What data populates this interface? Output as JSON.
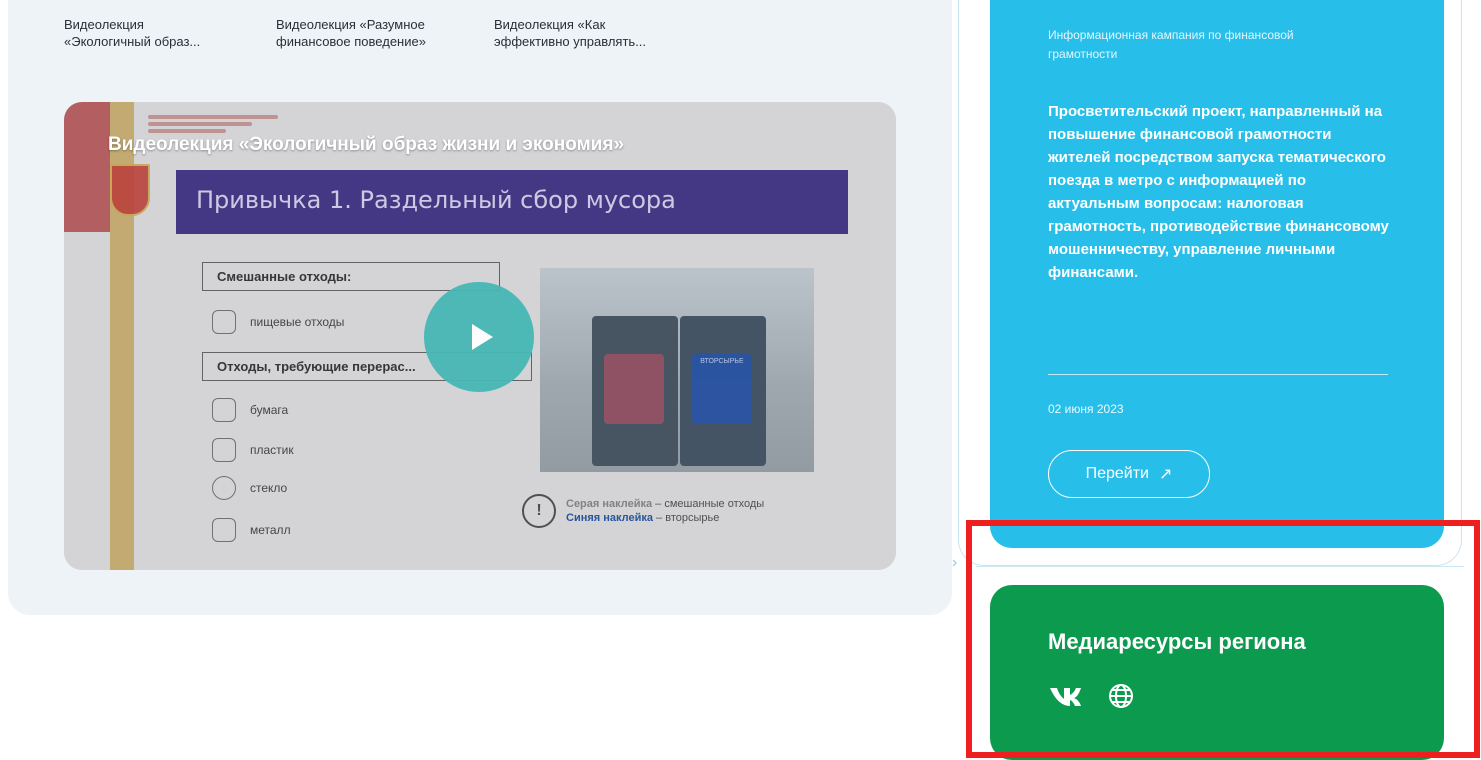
{
  "tabs": [
    {
      "line1": "Видеолекция",
      "line2": "«Экологичный образ..."
    },
    {
      "line1": "Видеолекция «Разумное",
      "line2": "финансовое поведение»"
    },
    {
      "line1": "Видеолекция «Как",
      "line2": "эффективно управлять..."
    }
  ],
  "video": {
    "title": "Видеолекция «Экологичный образ жизни и экономия»",
    "slide_heading": "Привычка 1. Раздельный сбор мусора",
    "mixed_header": "Смешанные отходы:",
    "food_waste": "пищевые отходы",
    "recycle_header": "Отходы, требующие перерас...",
    "paper": "бумага",
    "plastic": "пластик",
    "glass": "стекло",
    "metal": "металл",
    "legend_gray": "Серая наклейка",
    "legend_gray_rest": " – смешанные отходы",
    "legend_blue": "Синяя наклейка",
    "legend_blue_rest": " – вторсырье",
    "sticker_text": "ВТОРСЫРЬЕ"
  },
  "blue_card": {
    "category": "Информационная кампания по финансовой грамотности",
    "description": "Просветительский проект, направленный на повышение финансовой грамотности жителей посредством запуска тематического поезда в метро с информацией по актуальным вопросам: налоговая грамотность, противодействие финансовому мошенничеству, управление личными финансами.",
    "date": "02 июня 2023",
    "go_label": "Перейти",
    "go_arrow": "↗"
  },
  "green_card": {
    "title": "Медиаресурсы региона",
    "vk_label": "ВК"
  },
  "colors": {
    "blue_card": "#27bfe9",
    "green_card": "#0c9a4f",
    "highlight_frame": "#f01f1f",
    "play_button": "#46b7b5"
  }
}
